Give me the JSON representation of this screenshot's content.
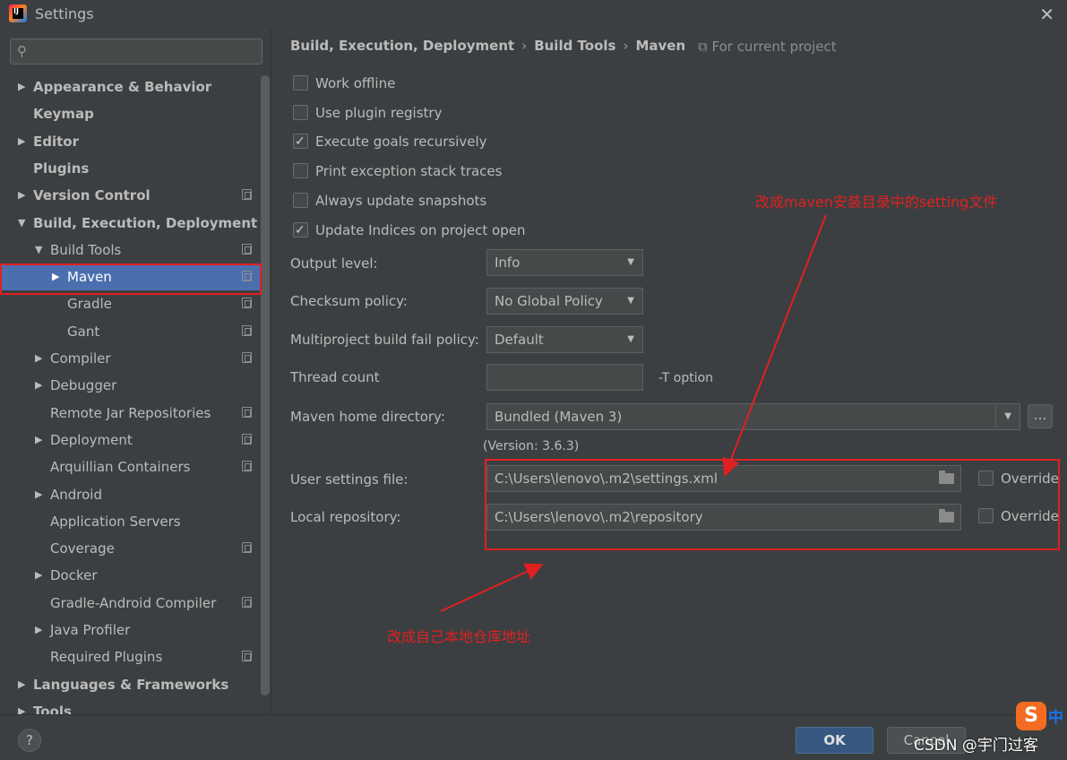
{
  "window": {
    "title": "Settings"
  },
  "search": {
    "placeholder": ""
  },
  "sidebar": {
    "items": [
      {
        "label": "Appearance & Behavior",
        "level": 0,
        "arrow": "▶",
        "bold": true,
        "proj": false
      },
      {
        "label": "Keymap",
        "level": 0,
        "arrow": "",
        "bold": true,
        "proj": false
      },
      {
        "label": "Editor",
        "level": 0,
        "arrow": "▶",
        "bold": true,
        "proj": false
      },
      {
        "label": "Plugins",
        "level": 0,
        "arrow": "",
        "bold": true,
        "proj": false
      },
      {
        "label": "Version Control",
        "level": 0,
        "arrow": "▶",
        "bold": true,
        "proj": true
      },
      {
        "label": "Build, Execution, Deployment",
        "level": 0,
        "arrow": "▼",
        "bold": true,
        "proj": false
      },
      {
        "label": "Build Tools",
        "level": 1,
        "arrow": "▼",
        "bold": false,
        "proj": true
      },
      {
        "label": "Maven",
        "level": 2,
        "arrow": "▶",
        "bold": false,
        "proj": true,
        "selected": true
      },
      {
        "label": "Gradle",
        "level": 2,
        "arrow": "",
        "bold": false,
        "proj": true
      },
      {
        "label": "Gant",
        "level": 2,
        "arrow": "",
        "bold": false,
        "proj": true
      },
      {
        "label": "Compiler",
        "level": 1,
        "arrow": "▶",
        "bold": false,
        "proj": true
      },
      {
        "label": "Debugger",
        "level": 1,
        "arrow": "▶",
        "bold": false,
        "proj": false
      },
      {
        "label": "Remote Jar Repositories",
        "level": 1,
        "arrow": "",
        "bold": false,
        "proj": true
      },
      {
        "label": "Deployment",
        "level": 1,
        "arrow": "▶",
        "bold": false,
        "proj": true
      },
      {
        "label": "Arquillian Containers",
        "level": 1,
        "arrow": "",
        "bold": false,
        "proj": true
      },
      {
        "label": "Android",
        "level": 1,
        "arrow": "▶",
        "bold": false,
        "proj": false
      },
      {
        "label": "Application Servers",
        "level": 1,
        "arrow": "",
        "bold": false,
        "proj": false
      },
      {
        "label": "Coverage",
        "level": 1,
        "arrow": "",
        "bold": false,
        "proj": true
      },
      {
        "label": "Docker",
        "level": 1,
        "arrow": "▶",
        "bold": false,
        "proj": false
      },
      {
        "label": "Gradle-Android Compiler",
        "level": 1,
        "arrow": "",
        "bold": false,
        "proj": true
      },
      {
        "label": "Java Profiler",
        "level": 1,
        "arrow": "▶",
        "bold": false,
        "proj": false
      },
      {
        "label": "Required Plugins",
        "level": 1,
        "arrow": "",
        "bold": false,
        "proj": true
      },
      {
        "label": "Languages & Frameworks",
        "level": 0,
        "arrow": "▶",
        "bold": true,
        "proj": false
      },
      {
        "label": "Tools",
        "level": 0,
        "arrow": "▶",
        "bold": true,
        "proj": false
      }
    ]
  },
  "breadcrumb": {
    "part1": "Build, Execution, Deployment",
    "sep": "›",
    "part2": "Build Tools",
    "part3": "Maven",
    "for_project": "For current project"
  },
  "options": {
    "work_offline": {
      "label": "Work offline",
      "checked": false
    },
    "plugin_registry": {
      "label": "Use plugin registry",
      "checked": false
    },
    "goals_recursive": {
      "label": "Execute goals recursively",
      "checked": true
    },
    "print_exception": {
      "label": "Print exception stack traces",
      "checked": false
    },
    "update_snapshots": {
      "label": "Always update snapshots",
      "checked": false
    },
    "update_indices": {
      "label": "Update Indices on project open",
      "checked": true
    }
  },
  "form": {
    "output_level": {
      "label": "Output level:",
      "value": "Info"
    },
    "checksum": {
      "label": "Checksum policy:",
      "value": "No Global Policy"
    },
    "fail_policy": {
      "label": "Multiproject build fail policy:",
      "value": "Default"
    },
    "thread_count": {
      "label": "Thread count",
      "value": "",
      "hint": "-T option"
    },
    "maven_home": {
      "label": "Maven home directory:",
      "value": "Bundled (Maven 3)",
      "browse": "...",
      "version": "(Version: 3.6.3)"
    },
    "user_settings": {
      "label": "User settings file:",
      "value": "C:\\Users\\lenovo\\.m2\\settings.xml",
      "override": "Override"
    },
    "local_repo": {
      "label": "Local repository:",
      "value": "C:\\Users\\lenovo\\.m2\\repository",
      "override": "Override"
    }
  },
  "annotations": {
    "settings_note": "改成maven安装目录中的setting文件",
    "repo_note": "改成自己本地仓库地址"
  },
  "footer": {
    "help": "?",
    "ok": "OK",
    "cancel": "Cancel",
    "watermark": "CSDN @宇门过客",
    "logo": "S",
    "logo_badge": "中"
  },
  "colors": {
    "selection": "#4b6eaf",
    "annotation": "#e02020",
    "ok_button": "#365880"
  }
}
